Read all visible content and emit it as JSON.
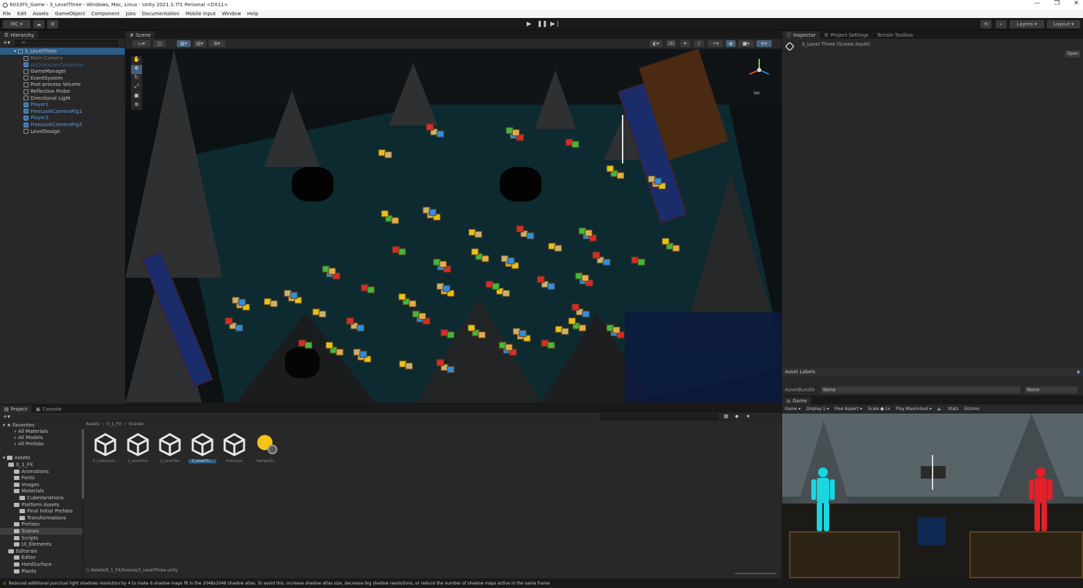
{
  "window": {
    "title": "6033FS_Game - 3_LevelThree - Windows, Mac, Linux - Unity 2021.3.7f1 Personal <DX11>",
    "controls": [
      "—",
      "❐",
      "✕"
    ]
  },
  "menu": [
    "File",
    "Edit",
    "Assets",
    "GameObject",
    "Component",
    "Jobs",
    "Documentation",
    "Mobile Input",
    "Window",
    "Help"
  ],
  "toolbar": {
    "account": "MC",
    "layers": "Layers",
    "layout": "Layout"
  },
  "hierarchy": {
    "tab": "Hierarchy",
    "search_placeholder": "All",
    "scene": "3_LevelThree",
    "items": [
      {
        "label": "Main Camera",
        "blue": false,
        "faded": true
      },
      {
        "label": "ArCharacterController",
        "blue": true,
        "faded": true
      },
      {
        "label": "GameManager",
        "blue": false,
        "faded": false
      },
      {
        "label": "EventSystem",
        "blue": false,
        "faded": false
      },
      {
        "label": "Post-process Volume",
        "blue": false,
        "faded": false
      },
      {
        "label": "Reflection Probe",
        "blue": false,
        "faded": false
      },
      {
        "label": "Directional Light",
        "blue": false,
        "faded": false
      },
      {
        "label": "Player1",
        "blue": true,
        "faded": false
      },
      {
        "label": "FreeLookCameraRig1",
        "blue": true,
        "faded": false
      },
      {
        "label": "Player2",
        "blue": true,
        "faded": false
      },
      {
        "label": "FreeLookCameraRig2",
        "blue": true,
        "faded": false
      },
      {
        "label": "LevelDesign",
        "blue": false,
        "faded": false
      }
    ]
  },
  "scene": {
    "tab": "Scene",
    "gizmo_label": "Iso",
    "tools": [
      "hand",
      "move",
      "rotate",
      "scale",
      "rect",
      "transform"
    ]
  },
  "inspector": {
    "tabs": [
      "Inspector",
      "Project Settings",
      "Terrain Toolbox"
    ],
    "asset_title": "3_Level Three (Scene Asset)",
    "open_button": "Open",
    "asset_labels": "Asset Labels",
    "asset_bundle_label": "AssetBundle",
    "asset_bundle_value": "None",
    "asset_bundle_variant": "None"
  },
  "game": {
    "tab": "Game",
    "mode": "Game",
    "display": "Display 1",
    "aspect": "Free Aspect",
    "scale_label": "Scale",
    "scale_value": "1x",
    "play_mode": "Play Maximized",
    "stats": "Stats",
    "gizmos": "Gizmos"
  },
  "project": {
    "tabs": [
      "Project",
      "Console"
    ],
    "breadcrumb": [
      "Assets",
      "0_1_FX",
      "Scenes"
    ],
    "favorites": "Favorites",
    "favorite_items": [
      "All Materials",
      "All Models",
      "All Prefabs"
    ],
    "assets_root": "Assets",
    "tree": [
      {
        "label": "0_1_FX",
        "depth": 1
      },
      {
        "label": "Animations",
        "depth": 2
      },
      {
        "label": "Fonts",
        "depth": 2
      },
      {
        "label": "Images",
        "depth": 2
      },
      {
        "label": "Materials",
        "depth": 2
      },
      {
        "label": "CubeVariations",
        "depth": 3
      },
      {
        "label": "Platform Assets",
        "depth": 2
      },
      {
        "label": "Final Initial Prefabs",
        "depth": 3
      },
      {
        "label": "Transformations",
        "depth": 3
      },
      {
        "label": "Prefabs",
        "depth": 2
      },
      {
        "label": "Scenes",
        "depth": 2,
        "selected": true
      },
      {
        "label": "Scripts",
        "depth": 2
      },
      {
        "label": "UI_Elements",
        "depth": 2
      },
      {
        "label": "Editorals",
        "depth": 1
      },
      {
        "label": "Editor",
        "depth": 2
      },
      {
        "label": "HardSurface",
        "depth": 2
      },
      {
        "label": "Plants",
        "depth": 2
      }
    ],
    "files": [
      {
        "label": "0_Lobbysele...",
        "type": "scene"
      },
      {
        "label": "1_LevelOne",
        "type": "scene"
      },
      {
        "label": "2_LevelTwo",
        "type": "scene"
      },
      {
        "label": "3_LevelTh...",
        "type": "scene",
        "selected": true
      },
      {
        "label": "Prototype",
        "type": "scene"
      },
      {
        "label": "SampleSc...",
        "type": "lighting"
      }
    ],
    "footer_path": "Assets/0_1_FX/Scenes/3_LevelThree.unity"
  },
  "status": {
    "message": "Reduced additional punctual light shadows resolution by 4 to make 6 shadow maps fit in the 2048x2048 shadow atlas. To avoid this, increase shadow atlas size, decrease big shadow resolutions, or reduce the number of shadow maps active in the same frame"
  },
  "colors": {
    "editor_bg": "#282828",
    "dark_bg": "#191919",
    "selection": "#2c5d87",
    "prefab_blue": "#5ca0e8",
    "player1": "#19d6e0",
    "player2": "#e3202a",
    "lightbulb": "#f2c418"
  }
}
